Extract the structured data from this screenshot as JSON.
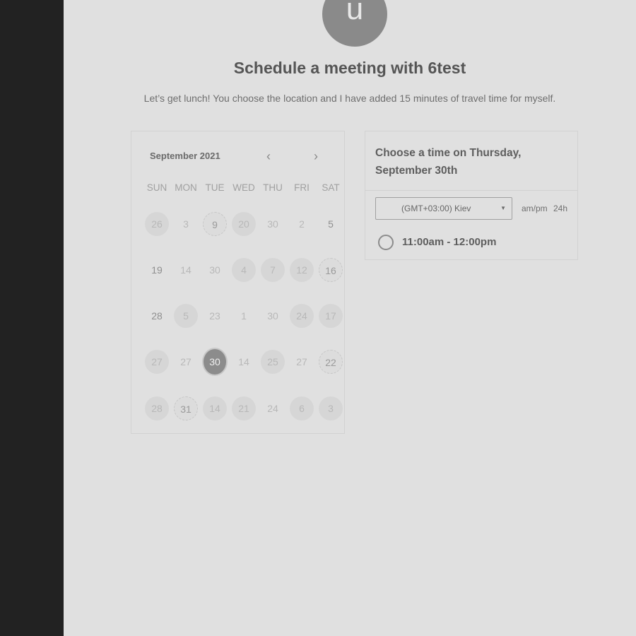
{
  "avatar": {
    "initial": "u"
  },
  "header": {
    "title": "Schedule a meeting with 6test",
    "subtitle": "Let’s get lunch! You choose the location and I have added 15 minutes of travel time for myself."
  },
  "calendar": {
    "month_label": "September 2021",
    "prev_icon": "chevron-left-icon",
    "next_icon": "chevron-right-icon",
    "weekdays": [
      "SUN",
      "MON",
      "TUE",
      "WED",
      "THU",
      "FRI",
      "SAT"
    ],
    "weeks": [
      [
        {
          "label": "26",
          "style": "filled"
        },
        {
          "label": "3",
          "style": "plain"
        },
        {
          "label": "9",
          "style": "dotted"
        },
        {
          "label": "20",
          "style": "filled"
        },
        {
          "label": "30",
          "style": "plain"
        },
        {
          "label": "2",
          "style": "plain"
        },
        {
          "label": "5",
          "style": "dark"
        }
      ],
      [
        {
          "label": "19",
          "style": "dark"
        },
        {
          "label": "14",
          "style": "plain"
        },
        {
          "label": "30",
          "style": "plain"
        },
        {
          "label": "4",
          "style": "filled"
        },
        {
          "label": "7",
          "style": "filled"
        },
        {
          "label": "12",
          "style": "filled"
        },
        {
          "label": "16",
          "style": "dotted"
        }
      ],
      [
        {
          "label": "28",
          "style": "dark"
        },
        {
          "label": "5",
          "style": "filled"
        },
        {
          "label": "23",
          "style": "plain"
        },
        {
          "label": "1",
          "style": "plain"
        },
        {
          "label": "30",
          "style": "plain"
        },
        {
          "label": "24",
          "style": "filled"
        },
        {
          "label": "17",
          "style": "filled"
        }
      ],
      [
        {
          "label": "27",
          "style": "filled"
        },
        {
          "label": "27",
          "style": "plain"
        },
        {
          "label": "30",
          "style": "selected"
        },
        {
          "label": "14",
          "style": "plain"
        },
        {
          "label": "25",
          "style": "filled"
        },
        {
          "label": "27",
          "style": "plain"
        },
        {
          "label": "22",
          "style": "dotted"
        }
      ],
      [
        {
          "label": "28",
          "style": "filled"
        },
        {
          "label": "31",
          "style": "dotted"
        },
        {
          "label": "14",
          "style": "filled"
        },
        {
          "label": "21",
          "style": "filled"
        },
        {
          "label": "24",
          "style": "plain"
        },
        {
          "label": "6",
          "style": "filled"
        },
        {
          "label": "3",
          "style": "filled"
        }
      ]
    ]
  },
  "time_panel": {
    "heading_line1": "Choose a time on Thursday,",
    "heading_line2": "September 30th",
    "timezone": "(GMT+03:00) Kiev",
    "caret_icon": "caret-down-icon",
    "format_ampm": "am/pm",
    "format_24h": "24h",
    "slots": [
      {
        "label": "11:00am - 12:00pm",
        "icon": "radio-icon"
      }
    ]
  }
}
